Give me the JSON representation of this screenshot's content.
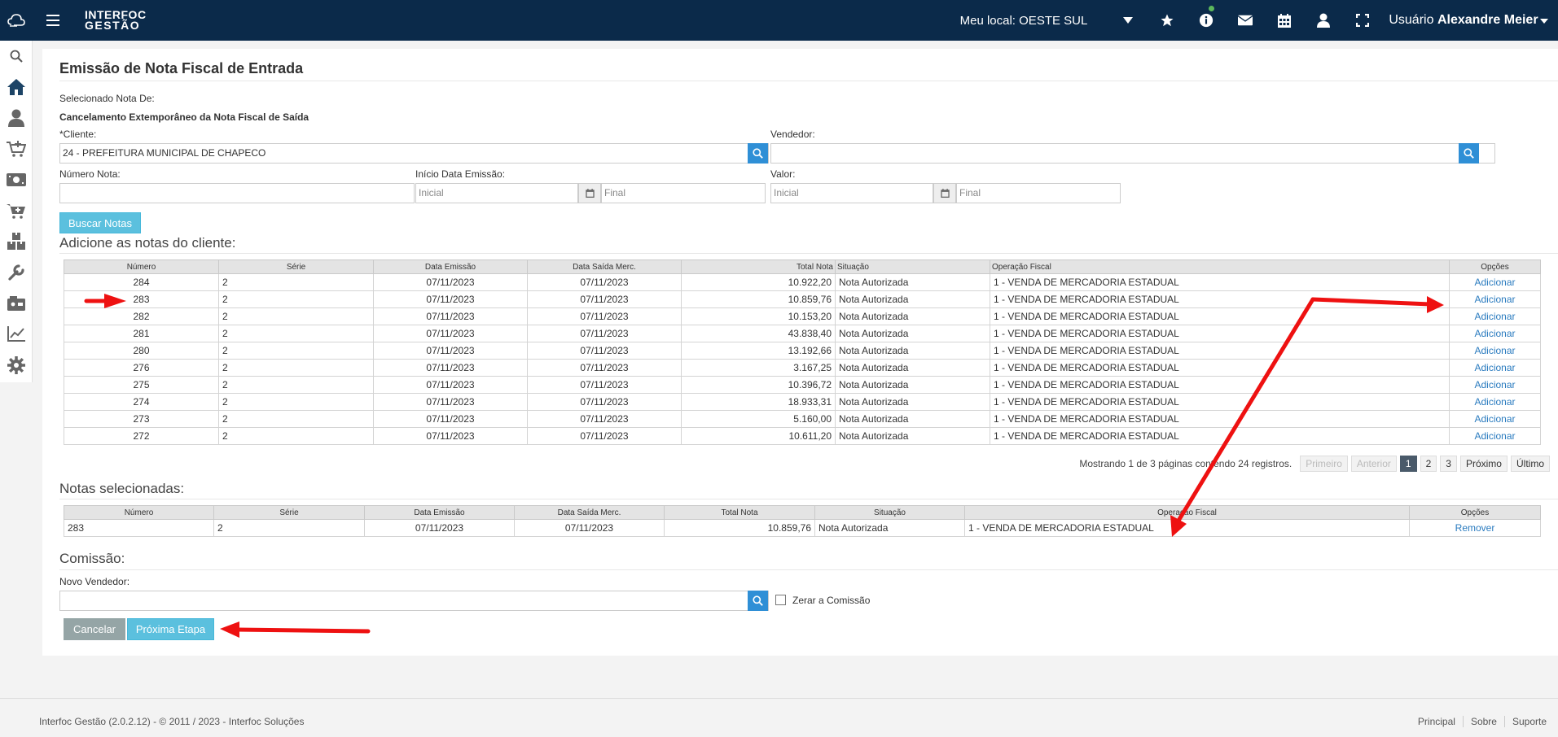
{
  "header": {
    "brand_line1": "INTERFOC",
    "brand_line2": "GESTÃO",
    "local_label": "Meu local: OESTE SUL",
    "user_prefix": "Usuário",
    "user_name": "Alexandre Meier"
  },
  "sidebar_icons": [
    "search-icon",
    "home-icon",
    "user-icon",
    "cart-add-icon",
    "money-icon",
    "cart-plus-icon",
    "boxes-icon",
    "wrench-icon",
    "cash-register-icon",
    "chart-icon",
    "gear-icon"
  ],
  "page": {
    "title": "Emissão de Nota Fiscal de Entrada",
    "selected_from_label": "Selecionado Nota De:",
    "selected_from_value": "Cancelamento Extemporâneo da Nota Fiscal de Saída"
  },
  "form": {
    "cliente_label": "*Cliente:",
    "cliente_value": "24 - PREFEITURA MUNICIPAL DE CHAPECO",
    "vendedor_label": "Vendedor:",
    "numero_label": "Número Nota:",
    "data_label": "Início Data Emissão:",
    "data_inicial_ph": "Inicial",
    "data_final_ph": "Final",
    "valor_label": "Valor:",
    "valor_inicial_ph": "Inicial",
    "valor_final_ph": "Final",
    "buscar_button": "Buscar Notas"
  },
  "notes_section": {
    "title": "Adicione as notas do cliente:",
    "columns": [
      "Número",
      "Série",
      "Data Emissão",
      "Data Saída Merc.",
      "Total Nota",
      "Situação",
      "Operação Fiscal",
      "Opções"
    ],
    "rows": [
      {
        "numero": "284",
        "serie": "2",
        "emissao": "07/11/2023",
        "saida": "07/11/2023",
        "total": "10.922,20",
        "situacao": "Nota Autorizada",
        "operacao": "1 - VENDA DE MERCADORIA ESTADUAL",
        "acao": "Adicionar"
      },
      {
        "numero": "283",
        "serie": "2",
        "emissao": "07/11/2023",
        "saida": "07/11/2023",
        "total": "10.859,76",
        "situacao": "Nota Autorizada",
        "operacao": "1 - VENDA DE MERCADORIA ESTADUAL",
        "acao": "Adicionar"
      },
      {
        "numero": "282",
        "serie": "2",
        "emissao": "07/11/2023",
        "saida": "07/11/2023",
        "total": "10.153,20",
        "situacao": "Nota Autorizada",
        "operacao": "1 - VENDA DE MERCADORIA ESTADUAL",
        "acao": "Adicionar"
      },
      {
        "numero": "281",
        "serie": "2",
        "emissao": "07/11/2023",
        "saida": "07/11/2023",
        "total": "43.838,40",
        "situacao": "Nota Autorizada",
        "operacao": "1 - VENDA DE MERCADORIA ESTADUAL",
        "acao": "Adicionar"
      },
      {
        "numero": "280",
        "serie": "2",
        "emissao": "07/11/2023",
        "saida": "07/11/2023",
        "total": "13.192,66",
        "situacao": "Nota Autorizada",
        "operacao": "1 - VENDA DE MERCADORIA ESTADUAL",
        "acao": "Adicionar"
      },
      {
        "numero": "276",
        "serie": "2",
        "emissao": "07/11/2023",
        "saida": "07/11/2023",
        "total": "3.167,25",
        "situacao": "Nota Autorizada",
        "operacao": "1 - VENDA DE MERCADORIA ESTADUAL",
        "acao": "Adicionar"
      },
      {
        "numero": "275",
        "serie": "2",
        "emissao": "07/11/2023",
        "saida": "07/11/2023",
        "total": "10.396,72",
        "situacao": "Nota Autorizada",
        "operacao": "1 - VENDA DE MERCADORIA ESTADUAL",
        "acao": "Adicionar"
      },
      {
        "numero": "274",
        "serie": "2",
        "emissao": "07/11/2023",
        "saida": "07/11/2023",
        "total": "18.933,31",
        "situacao": "Nota Autorizada",
        "operacao": "1 - VENDA DE MERCADORIA ESTADUAL",
        "acao": "Adicionar"
      },
      {
        "numero": "273",
        "serie": "2",
        "emissao": "07/11/2023",
        "saida": "07/11/2023",
        "total": "5.160,00",
        "situacao": "Nota Autorizada",
        "operacao": "1 - VENDA DE MERCADORIA ESTADUAL",
        "acao": "Adicionar"
      },
      {
        "numero": "272",
        "serie": "2",
        "emissao": "07/11/2023",
        "saida": "07/11/2023",
        "total": "10.611,20",
        "situacao": "Nota Autorizada",
        "operacao": "1 - VENDA DE MERCADORIA ESTADUAL",
        "acao": "Adicionar"
      }
    ],
    "pagination": {
      "info": "Mostrando 1 de 3 páginas contendo 24 registros.",
      "first": "Primeiro",
      "prev": "Anterior",
      "pages": [
        "1",
        "2",
        "3"
      ],
      "current_page": "1",
      "next": "Próximo",
      "last": "Último"
    }
  },
  "selected_section": {
    "title": "Notas selecionadas:",
    "rows": [
      {
        "numero": "283",
        "serie": "2",
        "emissao": "07/11/2023",
        "saida": "07/11/2023",
        "total": "10.859,76",
        "situacao": "Nota Autorizada",
        "operacao": "1 - VENDA DE MERCADORIA ESTADUAL",
        "acao": "Remover"
      }
    ]
  },
  "commission": {
    "title": "Comissão:",
    "new_seller_label": "Novo Vendedor:",
    "zero_label": "Zerar a Comissão",
    "cancel_button": "Cancelar",
    "next_button": "Próxima Etapa"
  },
  "footer": {
    "copyright": "Interfoc Gestão (2.0.2.12) - © 2011 / 2023 - Interfoc Soluções",
    "links": [
      "Principal",
      "Sobre",
      "Suporte"
    ]
  },
  "colors": {
    "topbar": "#0b2a4a",
    "search_button": "#2f8fd6",
    "info_button": "#5bc0de",
    "link": "#2a7bbf",
    "annotation_arrow": "#ee1111"
  }
}
